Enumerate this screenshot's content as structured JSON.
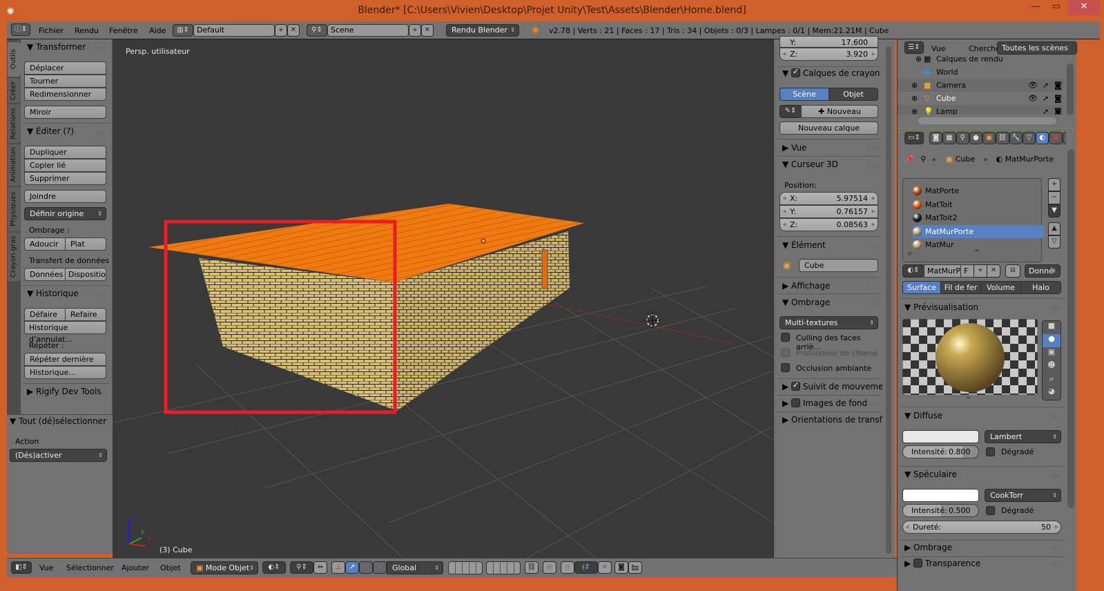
{
  "window": {
    "title": "Blender* [C:\\Users\\Vivien\\Desktop\\Projet Unity\\Test\\Assets\\Blender\\Home.blend]",
    "minimize": "—",
    "maximize": "▭",
    "close": "✕"
  },
  "info_header": {
    "menus": [
      "Fichier",
      "Rendu",
      "Fenêtre",
      "Aide"
    ],
    "layout": "Default",
    "scene": "Scene",
    "render_engine": "Rendu Blender",
    "stats": "v2.78 | Verts : 21 | Faces : 17 | Tris : 34 | Objets : 0/3 | Lampes : 0/1 | Mem:21.21M | Cube"
  },
  "tool_tabs": [
    "Outils",
    "Créer",
    "Relations",
    "Animation",
    "Physiques",
    "Crayon gras"
  ],
  "tool_shelf": {
    "transform": {
      "title": "Transformer",
      "buttons": [
        "Déplacer",
        "Tourner",
        "Redimensionner"
      ],
      "mirror": "Miroir"
    },
    "edit": {
      "title": "Éditer (?)",
      "buttons": [
        "Dupliquer",
        "Copier lié",
        "Supprimer"
      ],
      "join": "Joindre",
      "set_origin": "Définir origine"
    },
    "shading": {
      "label": "Ombrage :",
      "smooth": "Adoucir",
      "flat": "Plat"
    },
    "data_transfer": {
      "label": "Transfert de données :",
      "data": "Données",
      "layout": "Dispositio"
    },
    "history": {
      "title": "Historique",
      "undo": "Défaire",
      "redo": "Refaire",
      "undo_history": "Historique d’annulat...",
      "repeat_label": "Répéter :",
      "repeat_last": "Répéter dernière",
      "repeat_history": "Historique..."
    },
    "rigify": {
      "title": "Rigify Dev Tools"
    }
  },
  "operator_panel": {
    "title": "Tout (dé)sélectionner",
    "action_label": "Action",
    "action_value": "(Dés)activer"
  },
  "viewport": {
    "view_name": "Persp. utilisateur",
    "object_info": "(3) Cube",
    "axis": {
      "x": "x",
      "y": "y",
      "z": "z"
    }
  },
  "n_panel": {
    "location_y": {
      "label": "Y:",
      "value": "17.600"
    },
    "location_z": {
      "label": "Z:",
      "value": "3.920"
    },
    "grease_pencil": {
      "title": "Calques de crayon gras",
      "scene": "Scène",
      "object": "Objet",
      "new": "Nouveau",
      "new_layer": "Nouveau calque"
    },
    "view": {
      "title": "Vue"
    },
    "cursor": {
      "title": "Curseur 3D",
      "position_label": "Position:",
      "x": {
        "label": "X:",
        "value": "5.97514"
      },
      "y": {
        "label": "Y:",
        "value": "0.76157"
      },
      "z": {
        "label": "Z:",
        "value": "0.08563"
      }
    },
    "item": {
      "title": "Élément",
      "name": "Cube"
    },
    "display": {
      "title": "Affichage"
    },
    "shading": {
      "title": "Ombrage",
      "mode": "Multi-textures",
      "backface": "Culling des faces arriè...",
      "dof": "Profondeur de champ",
      "ao": "Occlusion ambiante"
    },
    "motion_tracking": {
      "title": "Suivit de mouvement"
    },
    "background_images": {
      "title": "Images de fond"
    },
    "transform_orientations": {
      "title": "Orientations de transform"
    }
  },
  "outliner": {
    "menus": [
      "Vue",
      "Chercher"
    ],
    "filter": "Toutes les scènes",
    "rows": [
      {
        "name": "Calques de rendu"
      },
      {
        "name": "World"
      },
      {
        "name": "Camera"
      },
      {
        "name": "Cube"
      },
      {
        "name": "Lamp"
      }
    ]
  },
  "properties": {
    "breadcrumb": {
      "object": "Cube",
      "material": "MatMurPorte"
    },
    "materials": [
      {
        "name": "MatPorte",
        "color": "#b84a10"
      },
      {
        "name": "MatToit",
        "color": "#e05a10"
      },
      {
        "name": "MatToit2",
        "color": "#1a1a1a"
      },
      {
        "name": "MatMurPorte",
        "color": "#b8a070",
        "selected": true
      },
      {
        "name": "MatMur",
        "color": "#b8a070"
      }
    ],
    "material_name": "MatMurP",
    "fake_user": "F",
    "link": "Donné",
    "tabs": [
      "Surface",
      "Fil de fer",
      "Volume",
      "Halo"
    ],
    "preview": {
      "title": "Prévisualisation"
    },
    "diffuse": {
      "title": "Diffuse",
      "shader": "Lambert",
      "intensity_label": "Intensité:",
      "intensity": "0.800",
      "intensity_fraction": 0.8,
      "ramp": "Dégradé"
    },
    "specular": {
      "title": "Spéculaire",
      "shader": "CookTorr",
      "intensity_label": "Intensité:",
      "intensity": "0.500",
      "intensity_fraction": 0.5,
      "ramp": "Dégradé",
      "hardness_label": "Dureté:",
      "hardness": "50"
    },
    "shading": {
      "title": "Ombrage"
    },
    "transparency": {
      "title": "Transparence"
    }
  },
  "bottom_header": {
    "menus": [
      "Vue",
      "Sélectionner",
      "Ajouter",
      "Objet"
    ],
    "mode": "Mode Objet",
    "orientation": "Global"
  },
  "colors": {
    "blender_orange": "#d0602a",
    "selection_blue": "#5680c2",
    "highlight_red": "#ed1c24",
    "roof": "#f07a10",
    "brick": "#d8c078"
  }
}
